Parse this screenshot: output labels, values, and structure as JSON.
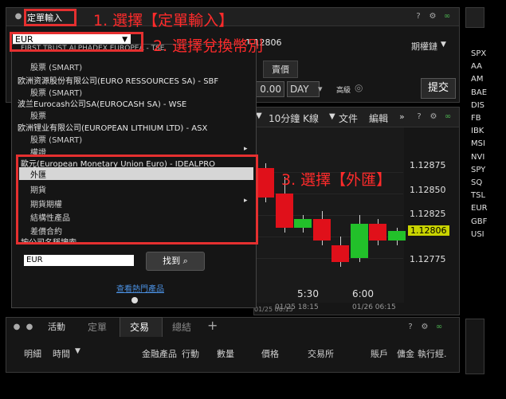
{
  "order_panel": {
    "title": "定單輸入",
    "symbol_value": "EUR",
    "chain_label": "期權鏈",
    "price_partial": "1.12806",
    "sell_label": "賣價",
    "price_value": "0.00",
    "tif": "DAY",
    "advanced": "高級",
    "submit": "提交"
  },
  "dropdown": {
    "items": [
      {
        "title": "FIRST TRUST ALPHADEX EUROPEA - TSE",
        "sub": "股票 (SMART)"
      },
      {
        "title": "欧洲资源股份有限公司(EURO RESSOURCES SA) - SBF",
        "sub": "股票 (SMART)"
      },
      {
        "title": "波兰Eurocash公司SA(EUROCASH SA) - WSE",
        "sub": "股票"
      },
      {
        "title": "欧洲锂业有限公司(EUROPEAN LITHIUM LTD) - ASX",
        "sub": "股票 (SMART)"
      }
    ],
    "more": "權證",
    "currency_title": "歐元(European Monetary Union Euro) - IDEALPRO",
    "currency_options": [
      "外匯",
      "期貨",
      "期貨期權",
      "結構性產品",
      "差價合約"
    ],
    "company_search": "按公司名稱搜索",
    "search_value": "EUR",
    "find_button": "找到",
    "popular_link": "查看熱門產品"
  },
  "chart": {
    "interval": "10分鐘 K線",
    "file": "文件",
    "edit": "編輯",
    "prices": [
      "1.12875",
      "1.12850",
      "1.12825",
      "1.12800",
      "1.12775"
    ],
    "current_price": "1.12806",
    "x_labels": [
      "5:30",
      "6:00"
    ],
    "dates": [
      "01/25 18:15",
      "01/26 06:15"
    ],
    "date_left": "01/25 06:15"
  },
  "chart_data": {
    "type": "candlestick",
    "candles": [
      {
        "open": 1.1288,
        "close": 1.12845,
        "high": 1.12885,
        "low": 1.1284,
        "dir": "down"
      },
      {
        "open": 1.1285,
        "close": 1.1281,
        "high": 1.1287,
        "low": 1.12805,
        "dir": "down"
      },
      {
        "open": 1.1281,
        "close": 1.1282,
        "high": 1.12825,
        "low": 1.12805,
        "dir": "up"
      },
      {
        "open": 1.1282,
        "close": 1.12795,
        "high": 1.1283,
        "low": 1.1279,
        "dir": "down"
      },
      {
        "open": 1.1279,
        "close": 1.1277,
        "high": 1.128,
        "low": 1.12765,
        "dir": "down"
      },
      {
        "open": 1.12775,
        "close": 1.12815,
        "high": 1.12825,
        "low": 1.1277,
        "dir": "up"
      },
      {
        "open": 1.12815,
        "close": 1.12795,
        "high": 1.1282,
        "low": 1.1279,
        "dir": "down"
      },
      {
        "open": 1.12795,
        "close": 1.12806,
        "high": 1.1281,
        "low": 1.1279,
        "dir": "up"
      }
    ],
    "ylim": [
      1.1276,
      1.1289
    ]
  },
  "tickers": [
    "SPX",
    "AA",
    "AM",
    "BAE",
    "DIS",
    "FB",
    "IBK",
    "MSI",
    "NVI",
    "SPY",
    "SQ",
    "TSL",
    "EUR",
    "GBF",
    "USI"
  ],
  "bottom_panel": {
    "tabs": [
      "活動",
      "定單",
      "交易",
      "總結"
    ],
    "add": "+",
    "columns": [
      "明細",
      "時間",
      "金融產品",
      "行動",
      "數量",
      "價格",
      "交易所",
      "賬戶",
      "傭金",
      "執行經."
    ]
  },
  "annotations": {
    "step1": "1. 選擇【定單輸入】",
    "step2": "2. 選擇兌換幣別",
    "step3": "3. 選擇【外匯】"
  },
  "colors": {
    "accent_red": "#e53030",
    "up": "#22c02a",
    "down": "#e0101a",
    "annot": "#ff2b2b"
  }
}
